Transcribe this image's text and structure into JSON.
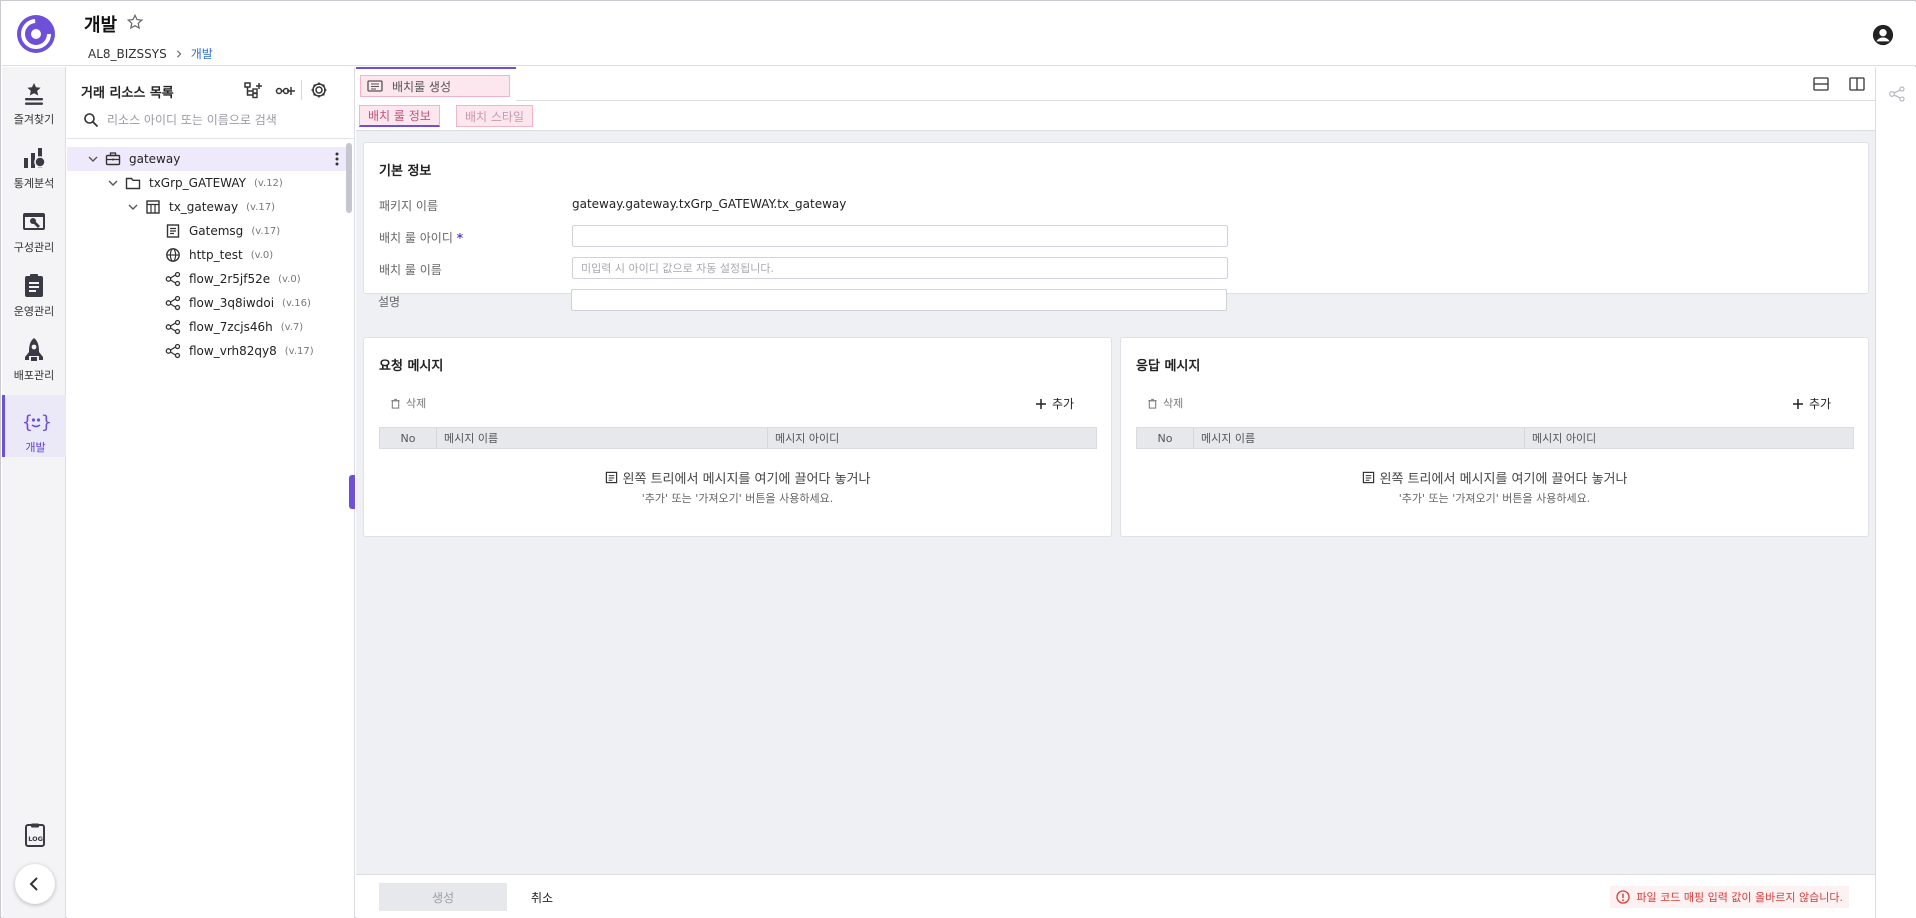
{
  "header": {
    "title": "개발",
    "breadcrumb": [
      "AL8_BIZSSYS",
      "개발"
    ]
  },
  "nav": {
    "items": [
      {
        "label": "즐겨찾기",
        "icon": "star-list-icon"
      },
      {
        "label": "통계분석",
        "icon": "chart-icon"
      },
      {
        "label": "구성관리",
        "icon": "config-icon"
      },
      {
        "label": "운영관리",
        "icon": "clipboard-icon"
      },
      {
        "label": "배포관리",
        "icon": "rocket-icon"
      },
      {
        "label": "개발",
        "icon": "dev-icon"
      }
    ]
  },
  "resource_panel": {
    "title": "거래 리소스 목록",
    "search_placeholder": "리소스 아이디 또는 이름으로 검색",
    "tree": [
      {
        "name": "gateway",
        "version": "",
        "icon": "briefcase-icon"
      },
      {
        "name": "txGrp_GATEWAY",
        "version": "(v.12)",
        "icon": "folder-icon"
      },
      {
        "name": "tx_gateway",
        "version": "(v.17)",
        "icon": "grid-icon"
      },
      {
        "name": "Gatemsg",
        "version": "(v.17)",
        "icon": "message-icon"
      },
      {
        "name": "http_test",
        "version": "(v.0)",
        "icon": "globe-icon"
      },
      {
        "name": "flow_2r5jf52e",
        "version": "(v.0)",
        "icon": "flow-icon"
      },
      {
        "name": "flow_3q8iwdoi",
        "version": "(v.16)",
        "icon": "flow-icon"
      },
      {
        "name": "flow_7zcjs46h",
        "version": "(v.7)",
        "icon": "flow-icon"
      },
      {
        "name": "flow_vrh82qy8",
        "version": "(v.17)",
        "icon": "flow-icon"
      }
    ]
  },
  "tabs": {
    "doc_tab": "배치룰 생성",
    "sub_tabs": [
      "배치 룰 정보",
      "배치 스타일"
    ]
  },
  "basic_info": {
    "title": "기본 정보",
    "package_label": "패키지 이름",
    "package_value": "gateway.gateway.txGrp_GATEWAY.tx_gateway",
    "id_label": "배치 룰 아이디",
    "required_mark": "*",
    "name_label": "배치 룰 이름",
    "name_placeholder": "미입력 시 아이디 값으로 자동 설정됩니다.",
    "desc_label": "설명"
  },
  "request_msg": {
    "title": "요청 메시지",
    "delete": "삭제",
    "add": "추가",
    "columns": [
      "No",
      "메시지 이름",
      "메시지 아이디"
    ],
    "empty_line1": "왼쪽 트리에서 메시지를 여기에 끌어다 놓거나",
    "empty_line2": "'추가' 또는 '가져오기' 버튼을 사용하세요."
  },
  "response_msg": {
    "title": "응답 메시지",
    "delete": "삭제",
    "add": "추가",
    "columns": [
      "No",
      "메시지 이름",
      "메시지 아이디"
    ],
    "empty_line1": "왼쪽 트리에서 메시지를 여기에 끌어다 놓거나",
    "empty_line2": "'추가' 또는 '가져오기' 버튼을 사용하세요."
  },
  "footer": {
    "create": "생성",
    "cancel": "취소",
    "error": "파일 코드 매핑 입력 값이 올바르지 않습니다."
  },
  "colors": {
    "accent": "#6d4fd8",
    "error": "#d93b3b",
    "tab_pink": "#fde7ee"
  }
}
